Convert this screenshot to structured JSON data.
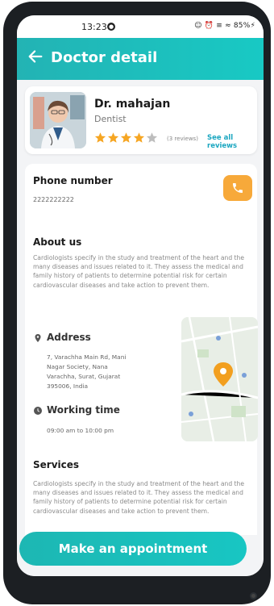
{
  "status_bar": {
    "time": "13:23",
    "indicators": "☺ ⏰ ≡ ≈ 85%⚡"
  },
  "app_bar": {
    "title": "Doctor detail",
    "back_icon": "arrow-left-icon"
  },
  "doctor": {
    "name": "Dr. mahajan",
    "specialty": "Dentist",
    "rating": 4,
    "rating_max": 5,
    "reviews_count": "(3 reviews)",
    "see_all_label": "See all reviews"
  },
  "contact": {
    "phone_heading": "Phone number",
    "phone_value": "2222222222",
    "call_icon": "phone-icon"
  },
  "about": {
    "heading": "About us",
    "text": "Cardiologists specify in the study and treatment of the heart and the many diseases and issues related to it. They assess the medical and family history of patients to determine potential risk for certain cardiovascular diseases and take action to prevent them."
  },
  "address": {
    "heading": "Address",
    "lines": [
      "7, Varachha Main Rd, Mani",
      "Nagar Society, Nana",
      "Varachha, Surat, Gujarat",
      "395006, India"
    ]
  },
  "working_time": {
    "heading": "Working time",
    "value": "09:00 am to 10:00 pm"
  },
  "services": {
    "heading": "Services",
    "text": "Cardiologists specify in the study and treatment of the heart and the many diseases and issues related to it. They assess the medical and family history of patients to determine potential risk for certain cardiovascular diseases and take action to prevent them."
  },
  "cta": {
    "label": "Make an appointment"
  },
  "colors": {
    "primary": "#1ab8b5",
    "accent": "#f7a93a",
    "link": "#1aa6c0",
    "star": "#f6a623"
  }
}
